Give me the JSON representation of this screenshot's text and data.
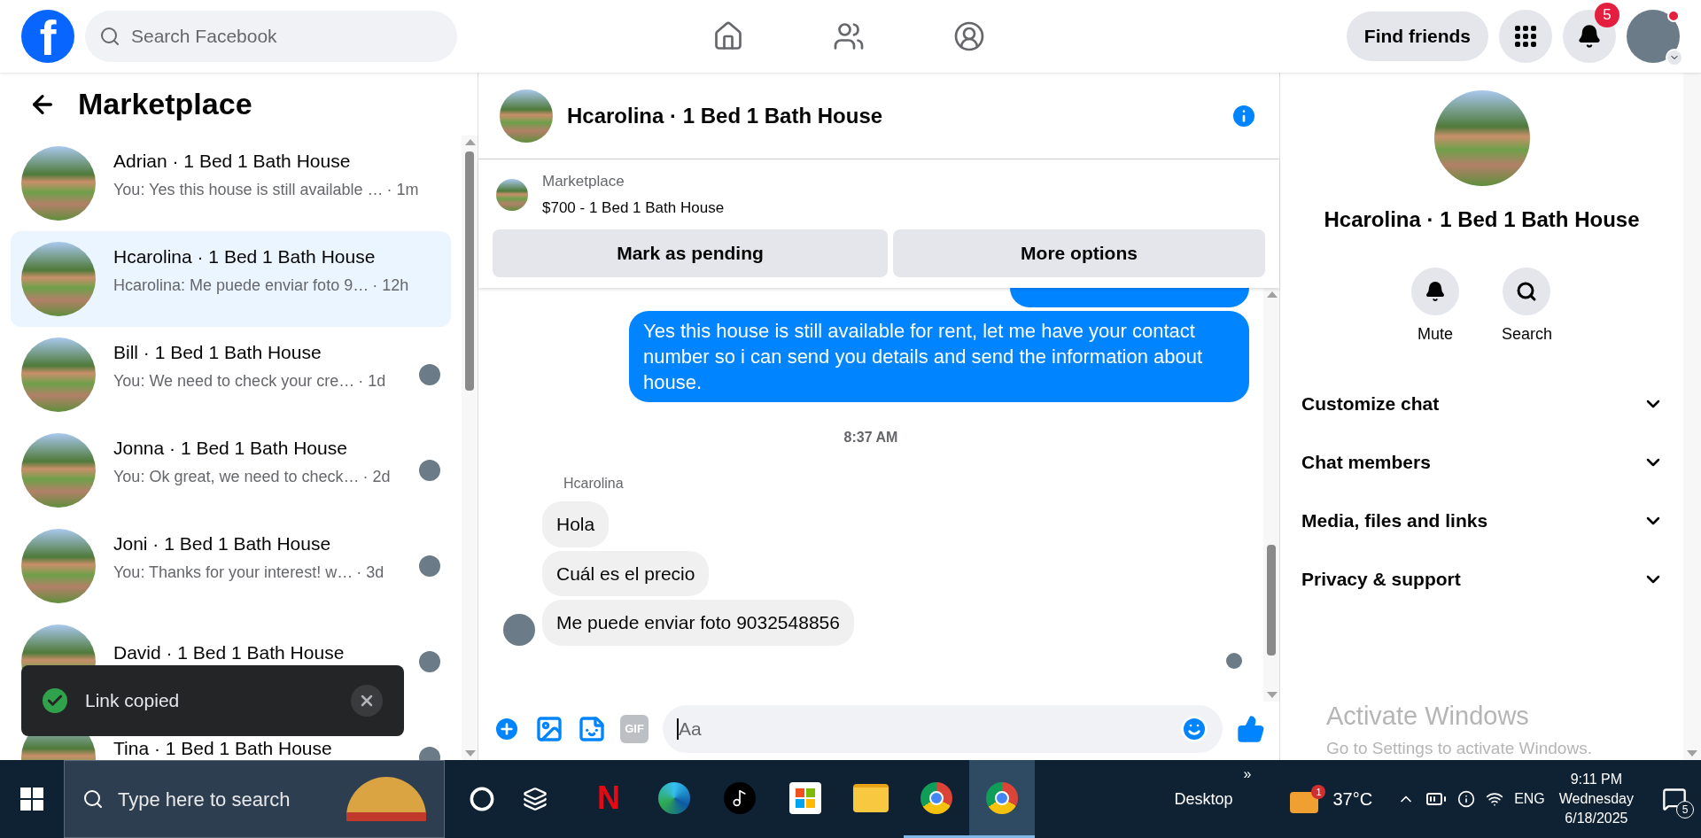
{
  "topbar": {
    "logo": "f",
    "search": {
      "placeholder": "Search Facebook"
    },
    "find_friends": "Find friends",
    "notifications_badge": "5",
    "profile_status_dot": true
  },
  "sidebar": {
    "title": "Marketplace",
    "conversations": [
      {
        "title": "Adrian · 1 Bed 1 Bath House",
        "preview": "You: Yes this house is still available …",
        "time": "· 1m",
        "selected": false,
        "seen_avatar": false
      },
      {
        "title": "Hcarolina · 1 Bed 1 Bath House",
        "preview": "Hcarolina: Me puede enviar foto 9…",
        "time": "· 12h",
        "selected": true,
        "seen_avatar": false
      },
      {
        "title": "Bill · 1 Bed 1 Bath House",
        "preview": "You: We need to check your cre…",
        "time": "· 1d",
        "selected": false,
        "seen_avatar": true
      },
      {
        "title": "Jonna · 1 Bed 1 Bath House",
        "preview": "You: Ok great, we need to check…",
        "time": "· 2d",
        "selected": false,
        "seen_avatar": true
      },
      {
        "title": "Joni · 1 Bed 1 Bath House",
        "preview": "You: Thanks for your interest! w…",
        "time": "· 3d",
        "selected": false,
        "seen_avatar": true
      },
      {
        "title": "David · 1 Bed 1 Bath House",
        "selected": false,
        "seen_avatar": true
      },
      {
        "title": "Tina · 1 Bed 1 Bath House",
        "selected": false,
        "seen_avatar": true
      }
    ]
  },
  "toast": {
    "text": "Link copied"
  },
  "chat": {
    "title": "Hcarolina · 1 Bed 1 Bath House",
    "listing": {
      "label": "Marketplace",
      "name": "$700 - 1 Bed 1 Bath House",
      "buttons": [
        "Mark as pending",
        "More options"
      ]
    },
    "messages": [
      {
        "kind": "outgoing_cut"
      },
      {
        "kind": "outgoing",
        "text": "Yes this house is still available for rent, let me have your contact number so i can send you details and send the information about house."
      },
      {
        "kind": "time",
        "text": "8:37 AM"
      },
      {
        "kind": "sender",
        "text": "Hcarolina"
      },
      {
        "kind": "incoming",
        "text": "Hola",
        "avatar": false
      },
      {
        "kind": "incoming",
        "text": "Cuál es el precio",
        "avatar": false
      },
      {
        "kind": "incoming",
        "text": "Me puede enviar foto 9032548856",
        "avatar": true
      },
      {
        "kind": "seen"
      }
    ],
    "composer": {
      "gif": "GIF",
      "placeholder": "Aa"
    }
  },
  "details": {
    "title": "Hcarolina · 1 Bed 1 Bath House",
    "actions": [
      {
        "kind": "mute",
        "label": "Mute"
      },
      {
        "kind": "search",
        "label": "Search"
      }
    ],
    "sections": [
      {
        "label": "Customize chat",
        "expanded": false
      },
      {
        "label": "Chat members",
        "expanded": false
      },
      {
        "label": "Media, files and links",
        "expanded": false
      },
      {
        "label": "Privacy & support",
        "expanded": false
      }
    ],
    "activation": {
      "title": "Activate Windows",
      "text": "Go to Settings to activate Windows."
    }
  },
  "taskbar": {
    "search": {
      "placeholder": "Type here to search"
    },
    "apps": [
      {
        "kind": "netflix",
        "glyph": "N",
        "open": false,
        "active": false
      },
      {
        "kind": "edge",
        "open": false,
        "active": false
      },
      {
        "kind": "tiktok",
        "open": false,
        "active": false
      },
      {
        "kind": "store",
        "open": false,
        "active": false
      },
      {
        "kind": "explorer",
        "open": false,
        "active": false
      },
      {
        "kind": "chrome",
        "open": true,
        "active": false
      },
      {
        "kind": "chrome",
        "open": true,
        "active": true
      }
    ],
    "desktop": "Desktop",
    "overflow": "»",
    "weather": {
      "badge": "1",
      "temp": "37°C"
    },
    "language": "ENG",
    "time": "9:11 PM",
    "day": "Wednesday",
    "date": "6/18/2025",
    "notifications_badge": "5"
  }
}
